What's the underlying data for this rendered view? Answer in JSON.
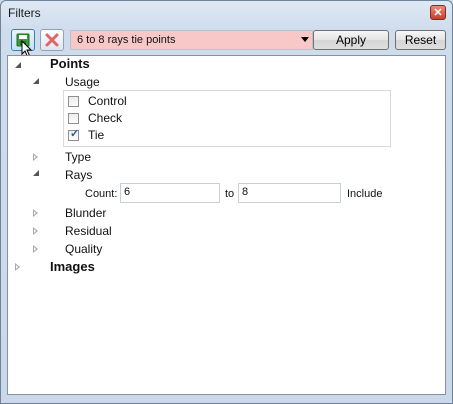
{
  "window": {
    "title": "Filters"
  },
  "toolbar": {
    "filter_select_value": "6 to 8 rays tie points",
    "apply_label": "Apply",
    "reset_label": "Reset"
  },
  "tree": {
    "points": {
      "label": "Points",
      "usage": {
        "label": "Usage",
        "options": [
          {
            "label": "Control",
            "checked": false
          },
          {
            "label": "Check",
            "checked": false
          },
          {
            "label": "Tie",
            "checked": true
          }
        ]
      },
      "type_label": "Type",
      "rays": {
        "label": "Rays",
        "count_label": "Count:",
        "min_value": "6",
        "to_label": "to",
        "max_value": "8",
        "include_label": "Include"
      },
      "blunder_label": "Blunder",
      "residual_label": "Residual",
      "quality_label": "Quality"
    },
    "images": {
      "label": "Images"
    }
  },
  "colors": {
    "filter_select_bg": "#f8c8c8",
    "check_mark": "#2d5a9a"
  }
}
